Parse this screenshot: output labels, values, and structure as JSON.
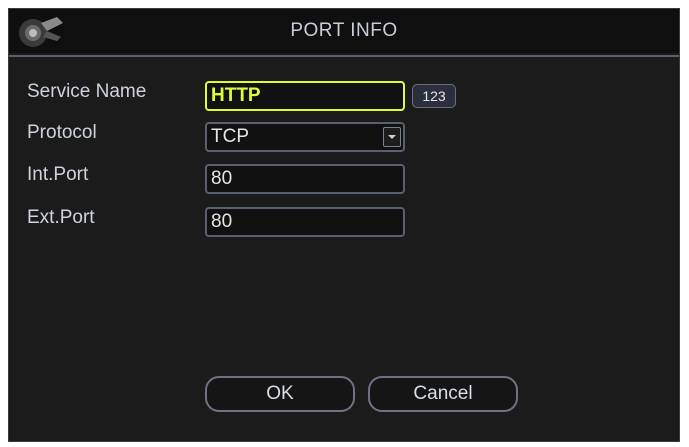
{
  "dialog": {
    "title": "PORT INFO"
  },
  "form": {
    "service_name_label": "Service Name",
    "service_name_value": "HTTP",
    "input_mode_badge": "123",
    "protocol_label": "Protocol",
    "protocol_value": "TCP",
    "int_port_label": "Int.Port",
    "int_port_value": "80",
    "ext_port_label": "Ext.Port",
    "ext_port_value": "80"
  },
  "buttons": {
    "ok_label": "OK",
    "cancel_label": "Cancel"
  },
  "colors": {
    "background": "#1b1b1b",
    "active_field": "#d8ff3a",
    "field_border": "#5b6070",
    "text": "#cfd3dd"
  },
  "icons": {
    "logo": "camera-logo-icon",
    "dropdown": "chevron-down-icon"
  }
}
